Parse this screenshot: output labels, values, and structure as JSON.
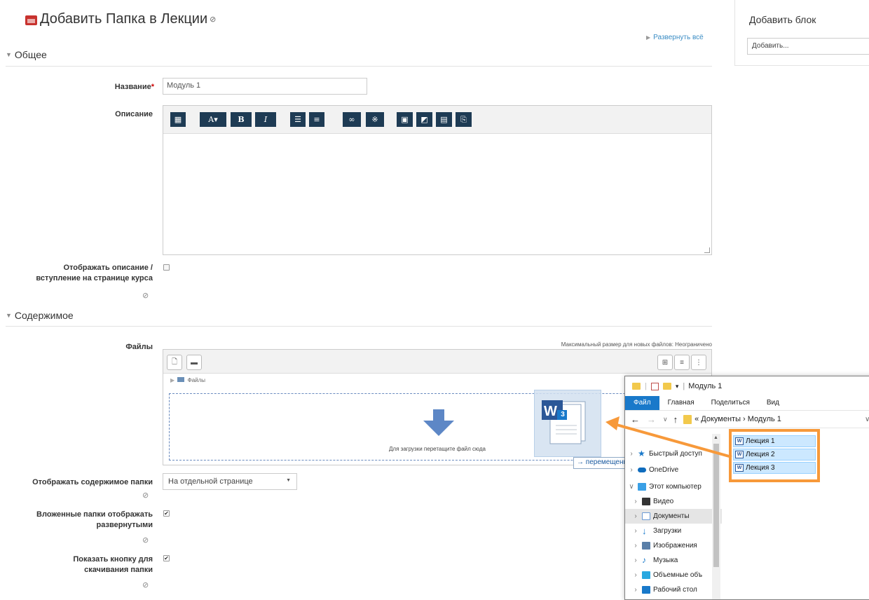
{
  "page": {
    "title": "Добавить Папка в Лекции",
    "expand_all": "Развернуть всё"
  },
  "sections": {
    "general": "Общее",
    "content": "Содержимое"
  },
  "form": {
    "name_label": "Название",
    "name_required_mark": "*",
    "name_value": "Модуль 1",
    "description_label": "Описание",
    "show_description_label_1": "Отображать описание /",
    "show_description_label_2": "вступление на странице курса",
    "show_description_checked": false,
    "files_label": "Файлы",
    "max_size_text": "Максимальный размер для новых файлов: Неограничено",
    "files_path": "Файлы",
    "drop_text": "Для загрузки перетащите файл сюда",
    "display_label": "Отображать содержимое папки",
    "display_value": "На отдельной странице",
    "subfolders_label_1": "Вложенные папки отображать",
    "subfolders_label_2": "развернутыми",
    "subfolders_checked": true,
    "download_label_1": "Показать кнопку для",
    "download_label_2": "скачивания папки",
    "download_checked": true
  },
  "editor": {
    "toolbar": [
      "table",
      "font-size",
      "bold",
      "italic",
      "bullet-list",
      "numbered-list",
      "link",
      "unlink",
      "image-library",
      "image",
      "media",
      "paste"
    ],
    "bold_label": "B",
    "italic_label": "I"
  },
  "drag": {
    "ghost_badge": "3",
    "move_tooltip": "→ перемещение"
  },
  "block": {
    "title": "Добавить блок",
    "select_value": "Добавить..."
  },
  "explorer": {
    "title": "Модуль 1",
    "ribbon": [
      "Файл",
      "Главная",
      "Поделиться",
      "Вид"
    ],
    "address": "« Документы › Модуль 1",
    "nav": [
      {
        "label": "Быстрый доступ",
        "icon": "star-icon"
      },
      {
        "label": "OneDrive",
        "icon": "cloud-icon"
      },
      {
        "label": "Этот компьютер",
        "icon": "computer-icon"
      },
      {
        "label": "Видео",
        "icon": "video-icon"
      },
      {
        "label": "Документы",
        "icon": "documents-icon"
      },
      {
        "label": "Загрузки",
        "icon": "downloads-icon"
      },
      {
        "label": "Изображения",
        "icon": "images-icon"
      },
      {
        "label": "Музыка",
        "icon": "music-icon"
      },
      {
        "label": "Объемные объ",
        "icon": "3d-objects-icon"
      },
      {
        "label": "Рабочий стол",
        "icon": "desktop-icon"
      }
    ],
    "files": [
      "Лекция 1",
      "Лекция 2",
      "Лекция 3"
    ]
  },
  "colors": {
    "accent_orange": "#f7993a",
    "toolbar_button": "#1e3b54",
    "link_blue": "#3a8cc4",
    "windows_blue": "#1979ca"
  }
}
